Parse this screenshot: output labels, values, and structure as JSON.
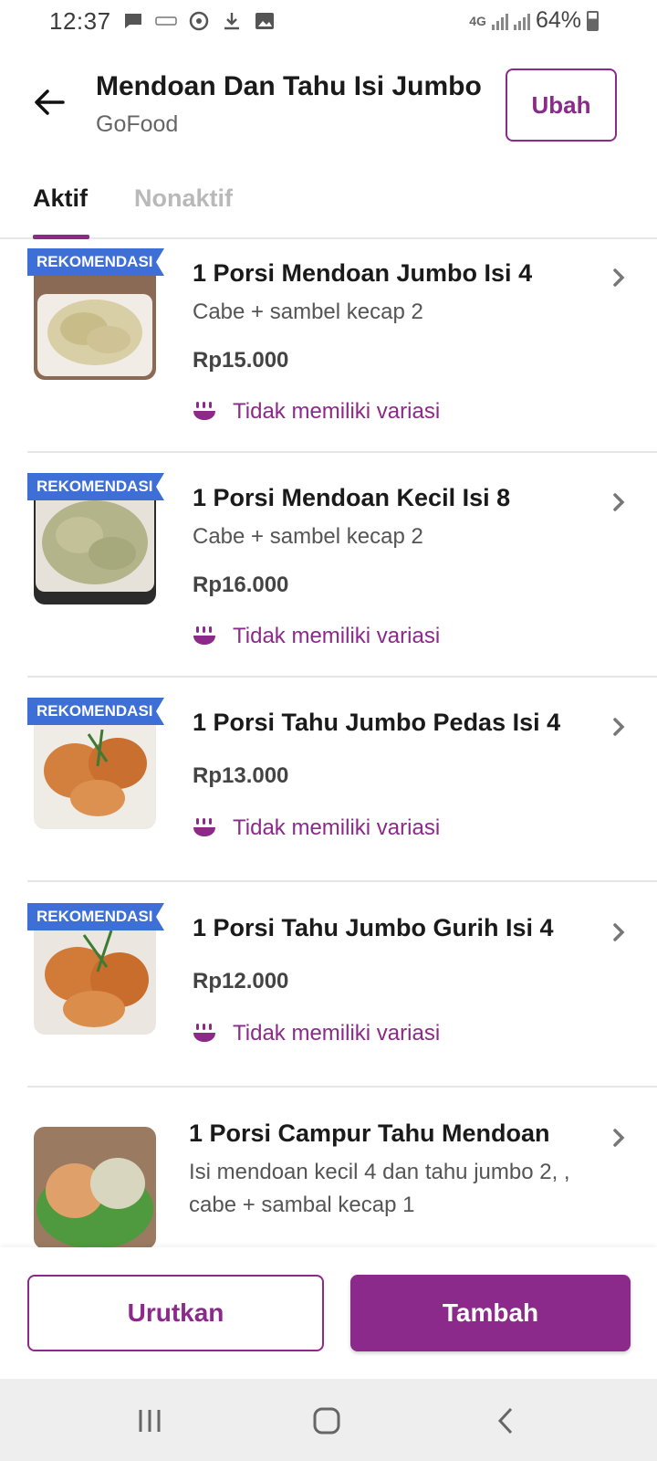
{
  "status_bar": {
    "time": "12:37",
    "network": "4G",
    "battery": "64%",
    "battery_level": 0.64
  },
  "header": {
    "title": "Mendoan Dan Tahu Isi Jumbo",
    "subtitle": "GoFood",
    "edit_label": "Ubah"
  },
  "tabs": {
    "active": "Aktif",
    "inactive": "Nonaktif"
  },
  "items": [
    {
      "badge": "REKOMENDASI",
      "title": "1 Porsi Mendoan Jumbo Isi 4",
      "desc": "Cabe + sambel kecap 2",
      "price": "Rp15.000",
      "variant": "Tidak memiliki variasi"
    },
    {
      "badge": "REKOMENDASI",
      "title": "1 Porsi Mendoan Kecil Isi 8",
      "desc": "Cabe + sambel kecap 2",
      "price": "Rp16.000",
      "variant": "Tidak memiliki variasi"
    },
    {
      "badge": "REKOMENDASI",
      "title": "1 Porsi Tahu Jumbo Pedas Isi 4",
      "price": "Rp13.000",
      "variant": "Tidak memiliki variasi"
    },
    {
      "badge": "REKOMENDASI",
      "title": "1 Porsi Tahu Jumbo Gurih Isi 4",
      "price": "Rp12.000",
      "variant": "Tidak memiliki variasi"
    },
    {
      "title": "1 Porsi Campur Tahu Mendoan",
      "desc_line1": "Isi mendoan kecil 4 dan tahu jumbo 2, ,",
      "desc_line2": "cabe + sambal kecap 1"
    }
  ],
  "actions": {
    "sort_label": "Urutkan",
    "add_label": "Tambah"
  },
  "colors": {
    "brand": "#8b2a8a",
    "badge": "#3d6fd6"
  }
}
